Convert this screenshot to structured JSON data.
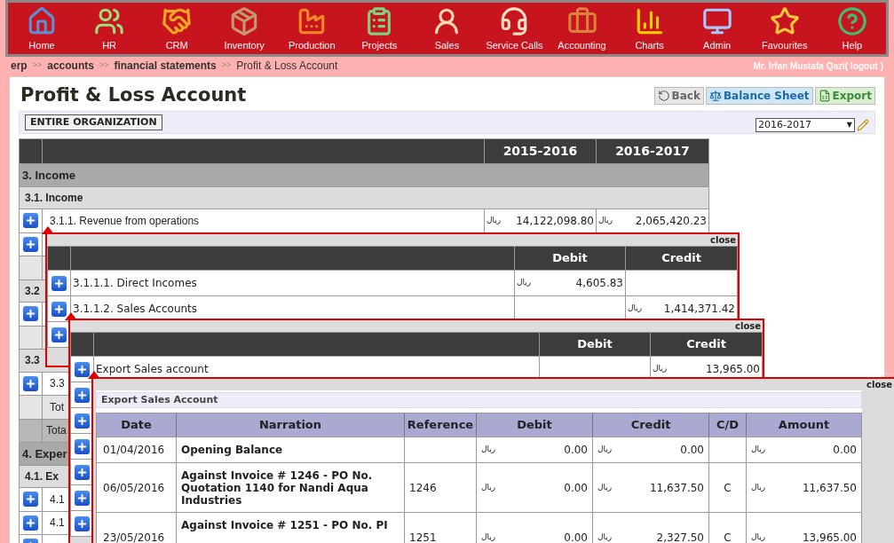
{
  "nav": [
    {
      "label": "Home"
    },
    {
      "label": "HR"
    },
    {
      "label": "CRM"
    },
    {
      "label": "Inventory"
    },
    {
      "label": "Production"
    },
    {
      "label": "Projects"
    },
    {
      "label": "Sales"
    },
    {
      "label": "Service Calls"
    },
    {
      "label": "Accounting"
    },
    {
      "label": "Charts"
    },
    {
      "label": "Admin"
    },
    {
      "label": "Favourites"
    },
    {
      "label": "Help"
    }
  ],
  "breadcrumb": [
    {
      "label": "erp",
      "sep": ">>",
      "current": false
    },
    {
      "label": "accounts",
      "sep": ">>",
      "current": false
    },
    {
      "label": "financial statements",
      "sep": ">>",
      "current": false
    },
    {
      "label": "Profit & Loss Account",
      "current": true
    }
  ],
  "user": {
    "name": "Mr. Irfan Mustafa Qazi(",
    "logout": "logout",
    "close": ")"
  },
  "title": "Profit & Loss Account",
  "actions": [
    {
      "label": "Back"
    },
    {
      "label": "Balance Sheet"
    },
    {
      "label": "Export"
    }
  ],
  "scope_button": "ENTIRE ORGANIZATION",
  "year_select": {
    "value": "2016-2017",
    "arrow": "▼"
  },
  "main_table": {
    "columns": [
      "2015-2016",
      "2016-2017"
    ],
    "rows": [
      {
        "kind": "section",
        "label": "3. Income"
      },
      {
        "kind": "subsection",
        "label": "3.1. Income"
      },
      {
        "kind": "account",
        "label": "3.1.1. Revenue from operations",
        "amount_2015_2016": {
          "currency": "ریال",
          "amount": "14,122,098.80"
        },
        "amount_2016_2017": {
          "currency": "ریال",
          "amount": "2,065,420.23"
        }
      },
      {
        "kind": "account"
      },
      {
        "kind": "total"
      },
      {
        "kind": "subsection",
        "label": "3.2"
      },
      {
        "kind": "account"
      },
      {
        "kind": "total"
      },
      {
        "kind": "subsection",
        "label": "3.3"
      },
      {
        "kind": "account",
        "label": "3.3"
      },
      {
        "kind": "total",
        "label": "Tot"
      },
      {
        "kind": "grand_total",
        "label": "Tota"
      },
      {
        "kind": "section",
        "label": "4. Exper"
      },
      {
        "kind": "subsection",
        "label": "4.1. Ex"
      },
      {
        "kind": "account",
        "label": "4.1"
      },
      {
        "kind": "account",
        "label": "4.1"
      },
      {
        "kind": "account"
      }
    ]
  },
  "popups": [
    {
      "close": "close",
      "columns": [
        "Debit",
        "Credit"
      ],
      "rows": [
        {
          "kind": "account",
          "label": "3.1.1.1. Direct Incomes",
          "debit": {
            "currency": "ریال",
            "amount": "4,605.83"
          }
        },
        {
          "kind": "account",
          "label": "3.1.1.2. Sales Accounts",
          "credit": {
            "currency": "ریال",
            "amount": "1,414,371.42"
          }
        },
        {
          "kind": "account"
        }
      ]
    },
    {
      "close": "close",
      "columns": [
        "Debit",
        "Credit"
      ],
      "rows": [
        {
          "kind": "account",
          "label": "Export Sales account",
          "credit": {
            "currency": "ریال",
            "amount": "13,965.00"
          }
        },
        {
          "kind": "account"
        },
        {
          "kind": "account"
        },
        {
          "kind": "account"
        },
        {
          "kind": "account"
        },
        {
          "kind": "account"
        },
        {
          "kind": "account"
        }
      ]
    }
  ],
  "ledger": {
    "close": "close",
    "title": "Export Sales Account",
    "columns": [
      "Date",
      "Narration",
      "Reference",
      "Debit",
      "Credit",
      "C/D",
      "Amount"
    ],
    "rows": [
      {
        "date": "01/04/2016",
        "narration": "Opening Balance",
        "debit": {
          "currency": "ریال",
          "amount": "0.00"
        },
        "credit": {
          "currency": "ریال",
          "amount": "0.00"
        },
        "amount": {
          "currency": "ریال",
          "amount": "0.00"
        }
      },
      {
        "date": "06/05/2016",
        "narration": "Against Invoice # 1246 - PO No. Quotation 1140 for Nandi Aqua Industries",
        "reference": "1246",
        "debit": {
          "currency": "ریال",
          "amount": "0.00"
        },
        "credit": {
          "currency": "ریال",
          "amount": "11,637.50"
        },
        "cd": "C",
        "amount": {
          "currency": "ریال",
          "amount": "11,637.50"
        }
      },
      {
        "date": "23/05/2016",
        "narration": "Against Invoice # 1251 - PO No. PI",
        "reference": "1251",
        "debit": {
          "currency": "ریال",
          "amount": "0.00"
        },
        "credit": {
          "currency": "ریال",
          "amount": "2,327.50"
        },
        "cd": "C",
        "amount": {
          "currency": "ریال",
          "amount": "13,965.00"
        }
      }
    ]
  }
}
